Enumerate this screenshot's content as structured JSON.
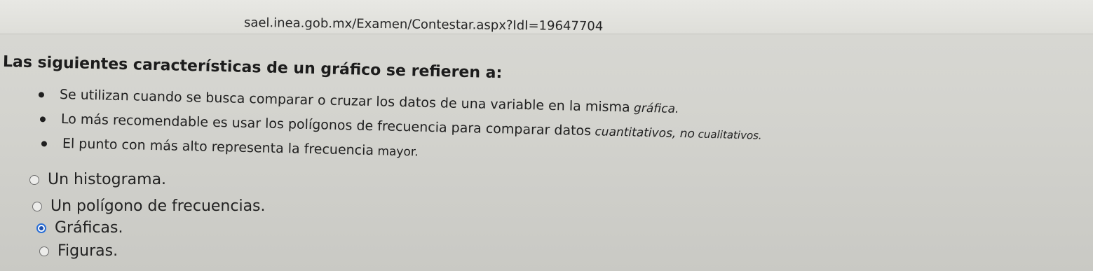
{
  "browser": {
    "url": "sael.inea.gob.mx/Examen/Contestar.aspx?IdI=19647704"
  },
  "question": {
    "title": "Las siguientes características de un gráfico se refieren a:",
    "bullets": [
      {
        "text": "Se utilizan cuando se busca comparar o cruzar los datos de una variable en la misma",
        "tail": " gráfica."
      },
      {
        "text": "Lo más recomendable es usar los polígonos de frecuencia para comparar datos",
        "tail": " cuantitativos, no",
        "tail2": " cualitativos."
      },
      {
        "text": "El punto con más alto representa la frecuencia",
        "tail": " mayor."
      }
    ]
  },
  "options": [
    {
      "label": "Un histograma.",
      "selected": false
    },
    {
      "label": "Un polígono de frecuencias.",
      "selected": false
    },
    {
      "label": "Gráficas.",
      "selected": true
    },
    {
      "label": "Figuras.",
      "selected": false
    }
  ],
  "colors": {
    "background": "#d3d3ce",
    "text": "#1f1f1f",
    "radio_selected": "#2b6fd6"
  }
}
